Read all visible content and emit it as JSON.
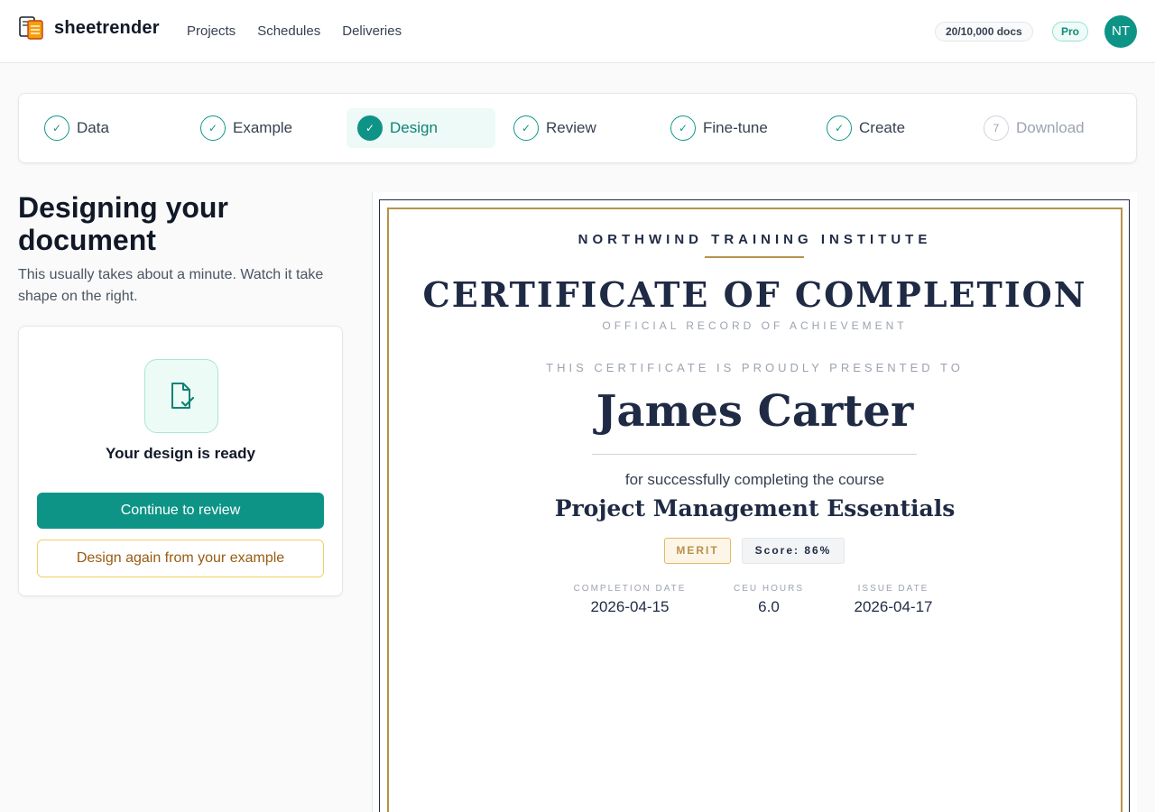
{
  "app": {
    "brand": "sheetrender",
    "nav": [
      "Projects",
      "Schedules",
      "Deliveries"
    ],
    "quota": "20/10,000 docs",
    "plan": "Pro",
    "avatar_initials": "NT",
    "accent_color": "#0e9486"
  },
  "stepper": {
    "steps": [
      {
        "label": "Data",
        "marker": "✓",
        "state": "done"
      },
      {
        "label": "Example",
        "marker": "✓",
        "state": "done"
      },
      {
        "label": "Design",
        "marker": "✓",
        "state": "active"
      },
      {
        "label": "Review",
        "marker": "✓",
        "state": "done"
      },
      {
        "label": "Fine-tune",
        "marker": "✓",
        "state": "done"
      },
      {
        "label": "Create",
        "marker": "✓",
        "state": "done"
      },
      {
        "label": "Download",
        "marker": "7",
        "state": "pending"
      }
    ]
  },
  "panel": {
    "title": "Designing your document",
    "subtitle": "This usually takes about a minute. Watch it take shape on the right.",
    "status_icon": "document-check-icon",
    "status_text": "Your design is ready",
    "primary_button": "Continue to review",
    "secondary_button": "Design again from your example"
  },
  "certificate": {
    "institute": "NORTHWIND TRAINING INSTITUTE",
    "title": "CERTIFICATE OF COMPLETION",
    "subtitle": "OFFICIAL RECORD OF ACHIEVEMENT",
    "presented_to": "THIS CERTIFICATE IS PROUDLY PRESENTED TO",
    "recipient": "James Carter",
    "for_text": "for successfully completing the course",
    "course": "Project Management Essentials",
    "badge": "MERIT",
    "score": "Score: 86%",
    "meta": [
      {
        "label": "COMPLETION DATE",
        "value": "2026-04-15"
      },
      {
        "label": "CEU HOURS",
        "value": "6.0"
      },
      {
        "label": "ISSUE DATE",
        "value": "2026-04-17"
      }
    ],
    "border_color": "#b8924a",
    "ink_color": "#1f2a44"
  }
}
